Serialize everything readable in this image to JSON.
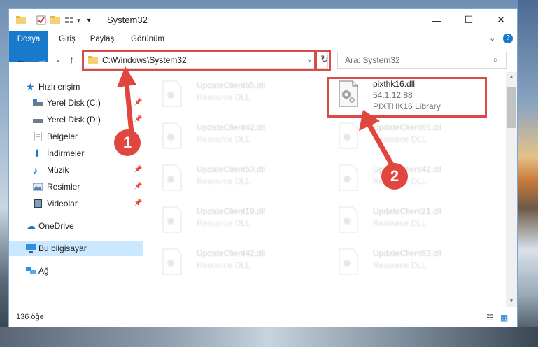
{
  "window": {
    "title": "System32"
  },
  "ribbon": {
    "tabs": [
      "Dosya",
      "Giriş",
      "Paylaş",
      "Görünüm"
    ]
  },
  "address": {
    "path": "C:\\Windows\\System32"
  },
  "search": {
    "placeholder": "Ara: System32"
  },
  "sidebar": {
    "items": [
      {
        "label": "Hızlı erişim"
      },
      {
        "label": "Yerel Disk (C:)"
      },
      {
        "label": "Yerel Disk (D:)"
      },
      {
        "label": "Belgeler"
      },
      {
        "label": "İndirmeler"
      },
      {
        "label": "Müzik"
      },
      {
        "label": "Resimler"
      },
      {
        "label": "Videolar"
      },
      {
        "label": "OneDrive"
      },
      {
        "label": "Bu bilgisayar"
      },
      {
        "label": "Ağ"
      }
    ]
  },
  "files": {
    "highlight": {
      "name": "pixthk16.dll",
      "version": "54.1.12.88",
      "desc": "PIXTHK16 Library"
    },
    "left": [
      {
        "name": "UpdateClient65.dll",
        "desc": "Resource DLL"
      },
      {
        "name": "UpdateClient42.dll",
        "desc": "Resource DLL"
      },
      {
        "name": "UpdateClient63.dll",
        "desc": "Resource DLL"
      },
      {
        "name": "UpdateClient19.dll",
        "desc": "Resource DLL"
      },
      {
        "name": "UpdateClient42.dll",
        "desc": "Resource DLL"
      }
    ],
    "right": [
      {
        "name": "UpdateClient65.dll",
        "desc": "Resource DLL"
      },
      {
        "name": "UpdateClient42.dll",
        "desc": "Resource DLL"
      },
      {
        "name": "UpdateClient21.dll",
        "desc": "Resource DLL"
      },
      {
        "name": "UpdateClient63.dll",
        "desc": "Resource DLL"
      }
    ]
  },
  "status": {
    "count": "136 öğe"
  },
  "annotations": {
    "badge1": "1",
    "badge2": "2"
  },
  "colors": {
    "accent": "#1979ca",
    "annotation_red": "#d94a48",
    "selected": "#cce8ff"
  }
}
